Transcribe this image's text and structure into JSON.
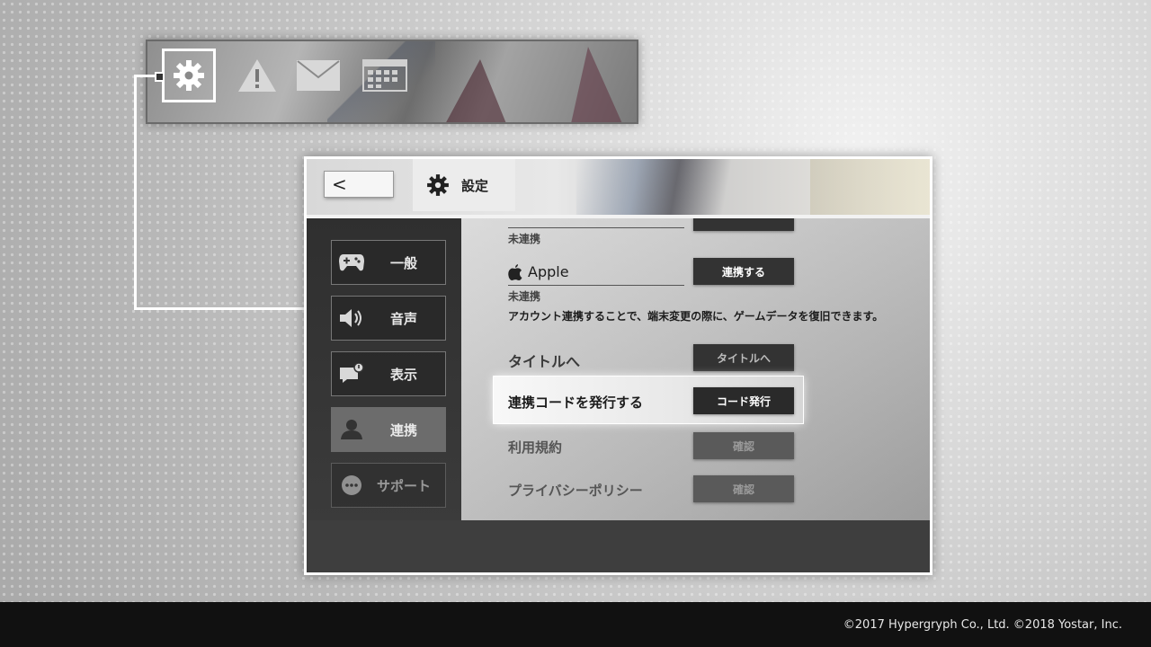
{
  "toolbar": {
    "icons": [
      "gear-icon",
      "warning-icon",
      "mail-icon",
      "calendar-icon"
    ]
  },
  "header": {
    "back_label": "<",
    "tab_title": "設定"
  },
  "sidebar": {
    "items": [
      {
        "label": "一般",
        "icon": "gamepad-icon"
      },
      {
        "label": "音声",
        "icon": "speaker-icon"
      },
      {
        "label": "表示",
        "icon": "notice-icon"
      },
      {
        "label": "連携",
        "icon": "user-icon"
      },
      {
        "label": "サポート",
        "icon": "chat-icon"
      }
    ],
    "active": "連携"
  },
  "content": {
    "prev_status": "未連携",
    "apple": {
      "name": "Apple",
      "status": "未連携",
      "button": "連携する"
    },
    "notice": "アカウント連携することで、端末変更の際に、ゲームデータを復旧できます。",
    "title_row": {
      "label": "タイトルへ",
      "button": "タイトルへ"
    },
    "code_row": {
      "label": "連携コードを発行する",
      "button": "コード発行"
    },
    "terms_row": {
      "label": "利用規約",
      "button": "確認"
    },
    "privacy_row": {
      "label": "プライバシーポリシー",
      "button": "確認"
    }
  },
  "footer": {
    "copyright": "©2017 Hypergryph Co., Ltd. ©2018 Yostar, Inc."
  },
  "colors": {
    "accent_white": "#ffffff",
    "dark_button": "#333333",
    "footer_bg": "#111111"
  }
}
